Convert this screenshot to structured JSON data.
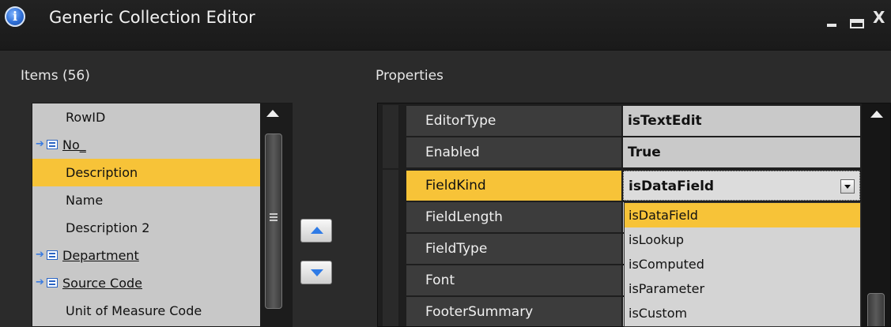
{
  "window": {
    "title": "Generic Collection Editor"
  },
  "items_panel": {
    "label": "Items (56)",
    "items": [
      {
        "label": "RowID",
        "key": false,
        "selected": false
      },
      {
        "label": "No_",
        "key": true,
        "selected": false
      },
      {
        "label": "Description",
        "key": false,
        "selected": true
      },
      {
        "label": "Name",
        "key": false,
        "selected": false
      },
      {
        "label": "Description 2",
        "key": false,
        "selected": false
      },
      {
        "label": "Department",
        "key": true,
        "selected": false
      },
      {
        "label": "Source Code",
        "key": true,
        "selected": false
      },
      {
        "label": "Unit of Measure Code",
        "key": false,
        "selected": false
      }
    ]
  },
  "properties_panel": {
    "label": "Properties",
    "rows": [
      {
        "name": "EditorType",
        "value": "isTextEdit"
      },
      {
        "name": "Enabled",
        "value": "True"
      },
      {
        "name": "FieldKind",
        "value": "isDataField"
      },
      {
        "name": "FieldLength",
        "value": ""
      },
      {
        "name": "FieldType",
        "value": ""
      },
      {
        "name": "Font",
        "value": ""
      },
      {
        "name": "FooterSummary",
        "value": ""
      }
    ],
    "dropdown_options": [
      "isDataField",
      "isLookup",
      "isComputed",
      "isParameter",
      "isCustom"
    ],
    "dropdown_selected": "isDataField"
  },
  "colors": {
    "selection": "#f7c338",
    "background": "#2b2b2b",
    "link_blue": "#2a64c4"
  }
}
